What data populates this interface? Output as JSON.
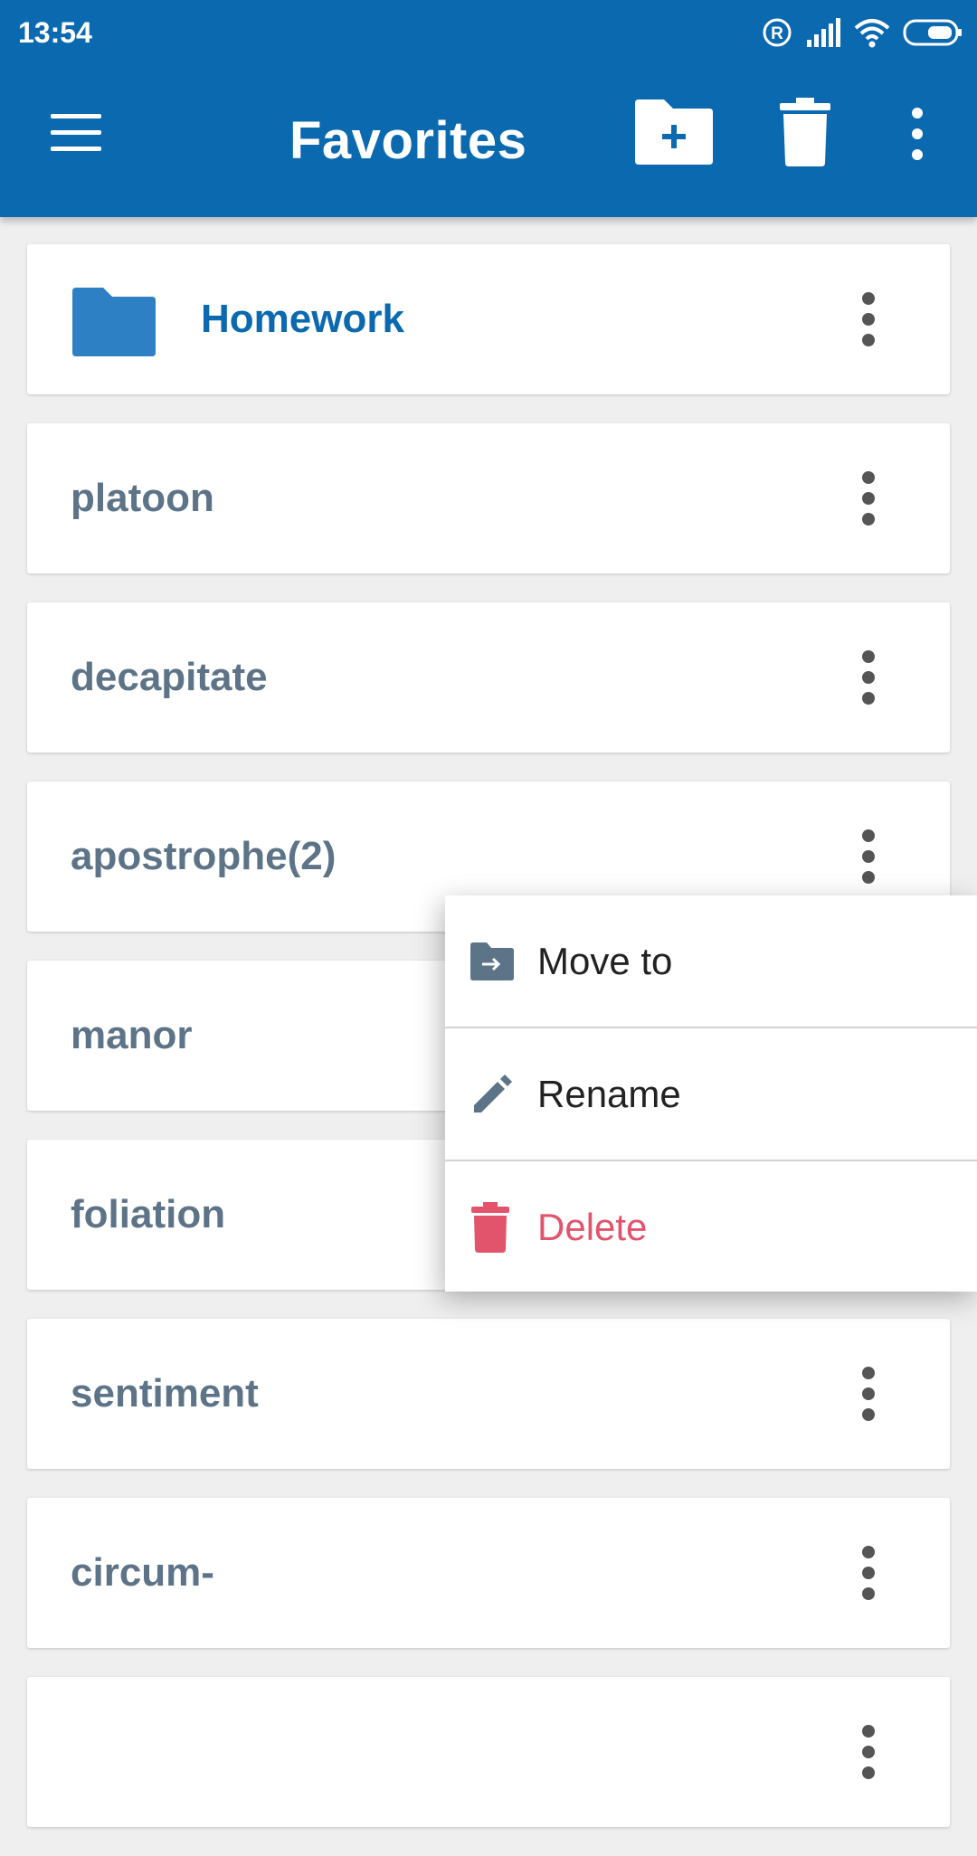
{
  "status_bar": {
    "time": "13:54"
  },
  "app_bar": {
    "title": "Favorites"
  },
  "list": {
    "items": [
      {
        "label": "Homework",
        "type": "folder"
      },
      {
        "label": "platoon"
      },
      {
        "label": "decapitate"
      },
      {
        "label": "apostrophe(2)"
      },
      {
        "label": "manor"
      },
      {
        "label": "foliation"
      },
      {
        "label": "sentiment"
      },
      {
        "label": "circum-"
      }
    ]
  },
  "context_menu": {
    "move_label": "Move to",
    "rename_label": "Rename",
    "delete_label": "Delete"
  },
  "colors": {
    "app_bar": "#0b69b0",
    "item_text": "#5d7387",
    "folder": "#2d80c4",
    "delete": "#e2546c"
  }
}
